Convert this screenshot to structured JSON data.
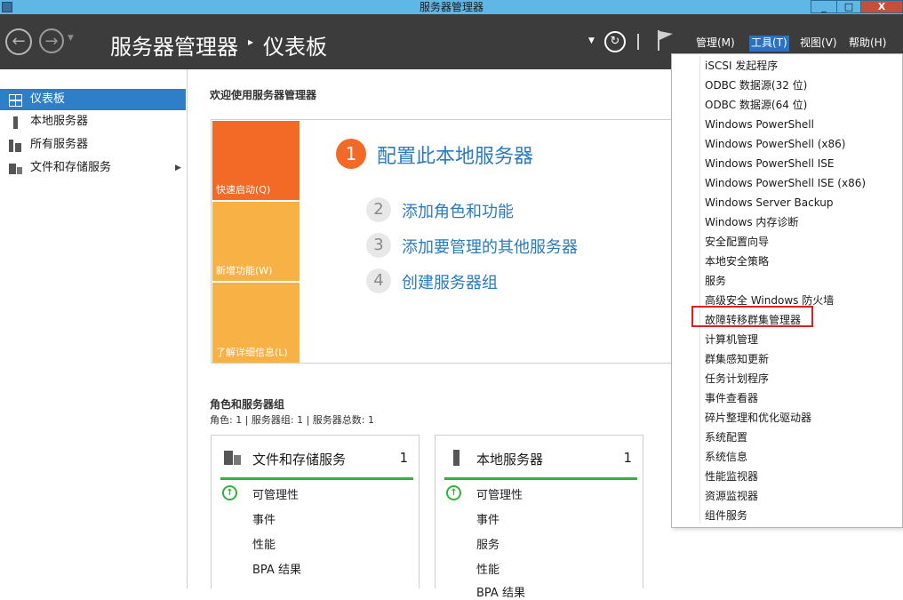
{
  "window": {
    "title": "服务器管理器",
    "min": "_",
    "max": "□",
    "close": "X"
  },
  "header": {
    "breadcrumb_root": "服务器管理器",
    "breadcrumb_sep": "▸",
    "breadcrumb_current": "仪表板",
    "menu": {
      "manage": "管理(M)",
      "tools": "工具(T)",
      "view": "视图(V)",
      "help": "帮助(H)"
    }
  },
  "sidebar": {
    "items": [
      {
        "label": "仪表板",
        "icon": "dashboard-icon",
        "selected": true
      },
      {
        "label": "本地服务器",
        "icon": "server-icon"
      },
      {
        "label": "所有服务器",
        "icon": "servers-icon"
      },
      {
        "label": "文件和存储服务",
        "icon": "storage-icon",
        "arrow": "▶"
      }
    ]
  },
  "main": {
    "welcome_title": "欢迎使用服务器管理器",
    "tiles": {
      "quick_start": "快速启动(Q)",
      "whats_new": "新增功能(W)",
      "learn_more": "了解详细信息(L)"
    },
    "steps": [
      {
        "num": "1",
        "label": "配置此本地服务器"
      },
      {
        "num": "2",
        "label": "添加角色和功能"
      },
      {
        "num": "3",
        "label": "添加要管理的其他服务器"
      },
      {
        "num": "4",
        "label": "创建服务器组"
      }
    ],
    "roles_title": "角色和服务器组",
    "roles_summary": "角色: 1 | 服务器组: 1 | 服务器总数: 1",
    "cards": [
      {
        "title": "文件和存储服务",
        "count": "1",
        "rows": [
          "可管理性",
          "事件",
          "性能",
          "BPA 结果"
        ]
      },
      {
        "title": "本地服务器",
        "count": "1",
        "rows": [
          "可管理性",
          "事件",
          "服务",
          "性能",
          "BPA 结果"
        ]
      }
    ]
  },
  "tools_menu": {
    "items": [
      "iSCSI 发起程序",
      "ODBC 数据源(32 位)",
      "ODBC 数据源(64 位)",
      "Windows PowerShell",
      "Windows PowerShell (x86)",
      "Windows PowerShell ISE",
      "Windows PowerShell ISE (x86)",
      "Windows Server Backup",
      "Windows 内存诊断",
      "安全配置向导",
      "本地安全策略",
      "服务",
      "高级安全 Windows 防火墙",
      "故障转移群集管理器",
      "计算机管理",
      "群集感知更新",
      "任务计划程序",
      "事件查看器",
      "碎片整理和优化驱动器",
      "系统配置",
      "系统信息",
      "性能监视器",
      "资源监视器",
      "组件服务"
    ],
    "highlighted": "故障转移群集管理器"
  },
  "colors": {
    "accent": "#2f7fc8",
    "orange": "#f26a26",
    "amber": "#f8b144",
    "ok_green": "#2fb33a",
    "highlight_red": "#e02020"
  }
}
